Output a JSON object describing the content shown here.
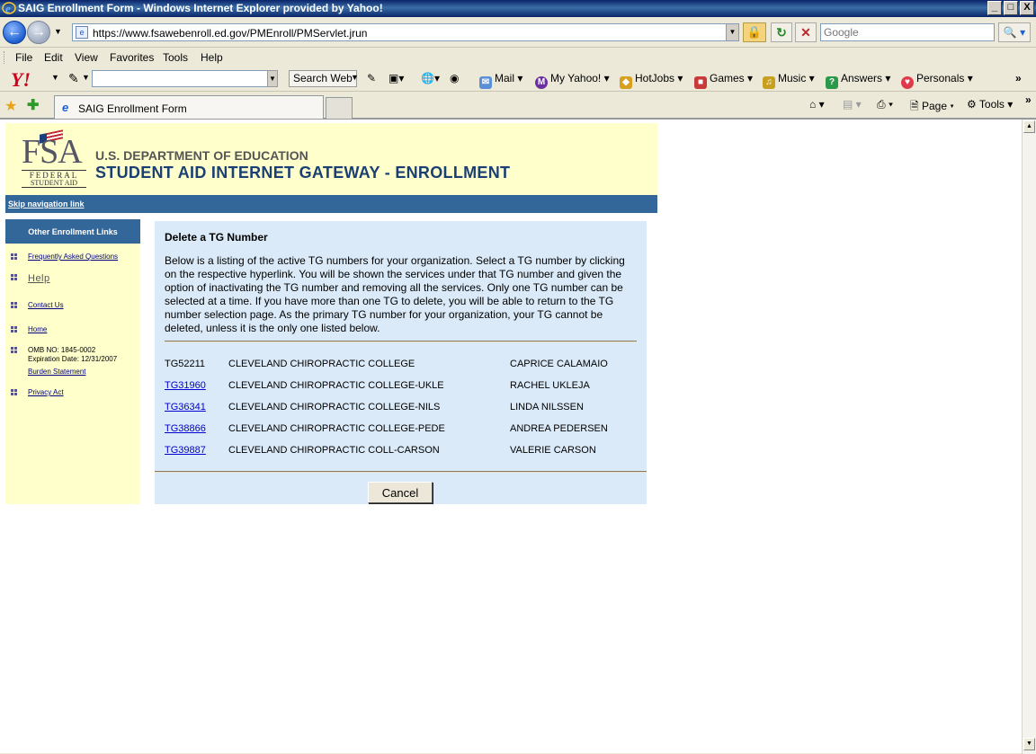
{
  "window": {
    "title": "SAIG Enrollment Form - Windows Internet Explorer provided by Yahoo!",
    "min_label": "_",
    "max_label": "□",
    "close_label": "X"
  },
  "address": {
    "url": "https://www.fsawebenroll.ed.gov/PMEnroll/PMServlet.jrun",
    "search_placeholder": "Google"
  },
  "menu": {
    "file": "File",
    "edit": "Edit",
    "view": "View",
    "favorites": "Favorites",
    "tools": "Tools",
    "help": "Help"
  },
  "yahoo_toolbar": {
    "logo": "Y!",
    "search_button": "Search Web",
    "mail": "Mail",
    "my_yahoo": "My Yahoo!",
    "hotjobs": "HotJobs",
    "games": "Games",
    "music": "Music",
    "answers": "Answers",
    "personals": "Personals",
    "more": "»"
  },
  "tabs": {
    "active_label": "SAIG Enrollment Form"
  },
  "command_bar": {
    "page": "Page",
    "tools": "Tools",
    "more": "»"
  },
  "header": {
    "logo_big": "FSA",
    "logo_federal": "FEDERAL",
    "logo_student_aid": "STUDENT AID",
    "department": "U.S. DEPARTMENT OF EDUCATION",
    "gateway_title": "STUDENT AID INTERNET GATEWAY - ENROLLMENT",
    "skip_link": "Skip navigation link"
  },
  "left_nav": {
    "heading": "Other Enrollment Links",
    "faq": "Frequently Asked Questions",
    "help": "Help",
    "contact": "Contact Us",
    "home": "Home",
    "omb": "OMB NO: 1845-0002",
    "expiration": "Expiration Date:  12/31/2007",
    "burden": "Burden Statement",
    "privacy": "Privacy Act"
  },
  "main": {
    "title": "Delete a TG Number",
    "intro": "Below is a listing of the active TG numbers for your organization. Select a TG number by clicking on the respective hyperlink. You will be shown the services under that TG number and given the option of inactivating the TG number and removing all the services. Only one TG number can be selected at a time. If you have more than one TG to delete, you will be able to return to the TG number selection page. As the primary TG number for your organization, your TG cannot be deleted, unless it is the only one listed below.",
    "rows": [
      {
        "tg": "TG52211",
        "school": "CLEVELAND CHIROPRACTIC COLLEGE",
        "contact": "CAPRICE CALAMAIO"
      },
      {
        "tg": "TG31960",
        "school": "CLEVELAND CHIROPRACTIC COLLEGE-UKLE",
        "contact": "RACHEL UKLEJA"
      },
      {
        "tg": "TG36341",
        "school": "CLEVELAND CHIROPRACTIC COLLEGE-NILS",
        "contact": "LINDA NILSSEN"
      },
      {
        "tg": "TG38866",
        "school": "CLEVELAND CHIROPRACTIC COLLEGE-PEDE",
        "contact": "ANDREA PEDERSEN"
      },
      {
        "tg": "TG39887",
        "school": "CLEVELAND CHIROPRACTIC COLL-CARSON",
        "contact": "VALERIE CARSON"
      }
    ],
    "cancel_label": "Cancel"
  }
}
